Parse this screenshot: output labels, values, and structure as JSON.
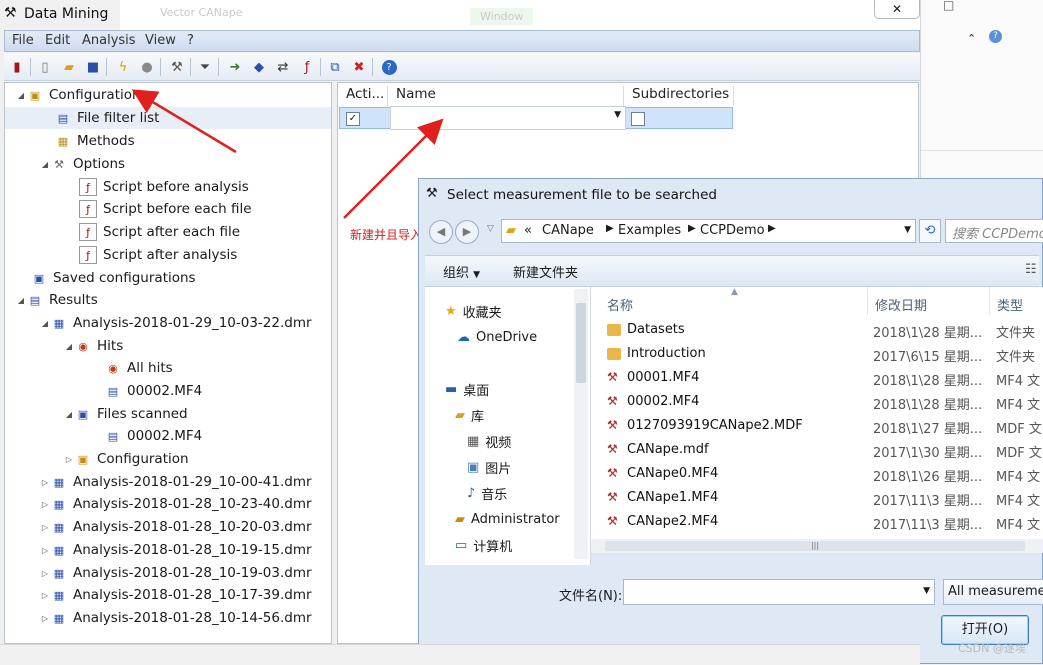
{
  "app": {
    "title": "Data Mining",
    "background_window": {
      "item_a": "Vector CANape",
      "item_b": "Window"
    },
    "menu": [
      "File",
      "Edit",
      "Analysis",
      "View",
      "?"
    ]
  },
  "tree": {
    "configuration": "Configuration",
    "file_filter_list": "File filter list",
    "methods": "Methods",
    "options": "Options",
    "script_before_analysis": "Script before analysis",
    "script_before_each_file": "Script before each file",
    "script_after_each_file": "Script after each file",
    "script_after_analysis": "Script after analysis",
    "saved_configurations": "Saved configurations",
    "results": "Results",
    "analysis_1": "Analysis-2018-01-29_10-03-22.dmr",
    "hits": "Hits",
    "all_hits": "All hits",
    "hit_file": "00002.MF4",
    "files_scanned": "Files scanned",
    "scanned_file": "00002.MF4",
    "result_configuration": "Configuration",
    "analyses": [
      "Analysis-2018-01-29_10-00-41.dmr",
      "Analysis-2018-01-28_10-23-40.dmr",
      "Analysis-2018-01-28_10-20-03.dmr",
      "Analysis-2018-01-28_10-19-15.dmr",
      "Analysis-2018-01-28_10-19-03.dmr",
      "Analysis-2018-01-28_10-17-39.dmr",
      "Analysis-2018-01-28_10-14-56.dmr"
    ]
  },
  "grid": {
    "col_active": "Acti...",
    "col_name": "Name",
    "col_subdirectories": "Subdirectories",
    "row_active_checked": "✓"
  },
  "annotation": {
    "text": "新建并且导入测量文件",
    "color": "#d62020"
  },
  "dialog": {
    "title": "Select measurement file to be searched",
    "breadcrumb": [
      "«",
      "CANape",
      "Examples",
      "CCPDemo"
    ],
    "search_placeholder": "搜索 CCPDemo",
    "organize": "组织",
    "new_folder": "新建文件夹",
    "nav": {
      "favorites": "收藏夹",
      "onedrive": "OneDrive",
      "desktop": "桌面",
      "library": "库",
      "video": "视频",
      "pictures": "图片",
      "music": "音乐",
      "administrator": "Administrator",
      "computer": "计算机"
    },
    "columns": {
      "name": "名称",
      "date": "修改日期",
      "type": "类型"
    },
    "files": [
      {
        "name": "Datasets",
        "date": "2018\\1\\28 星期...",
        "type": "文件夹",
        "kind": "folder"
      },
      {
        "name": "Introduction",
        "date": "2017\\6\\15 星期...",
        "type": "文件夹",
        "kind": "folder"
      },
      {
        "name": "00001.MF4",
        "date": "2018\\1\\28 星期...",
        "type": "MF4 文",
        "kind": "mf"
      },
      {
        "name": "00002.MF4",
        "date": "2018\\1\\28 星期...",
        "type": "MF4 文",
        "kind": "mf"
      },
      {
        "name": "0127093919CANape2.MDF",
        "date": "2018\\1\\27 星期...",
        "type": "MDF 文",
        "kind": "mf"
      },
      {
        "name": "CANape.mdf",
        "date": "2017\\1\\30 星期...",
        "type": "MDF 文",
        "kind": "mf"
      },
      {
        "name": "CANape0.MF4",
        "date": "2018\\1\\26 星期...",
        "type": "MF4 文",
        "kind": "mf"
      },
      {
        "name": "CANape1.MF4",
        "date": "2017\\11\\3 星期...",
        "type": "MF4 文",
        "kind": "mf"
      },
      {
        "name": "CANape2.MF4",
        "date": "2017\\11\\3 星期...",
        "type": "MF4 文",
        "kind": "mf"
      }
    ],
    "filename_label": "文件名(N):",
    "filename_value": "",
    "filter": "All measurement",
    "open_button": "打开(O)"
  },
  "watermark": "CSDN @逐埃",
  "colors": {
    "accent": "#3c7fb1",
    "annotation_arrow": "#e0201c",
    "selection": "#cfe3fa"
  }
}
